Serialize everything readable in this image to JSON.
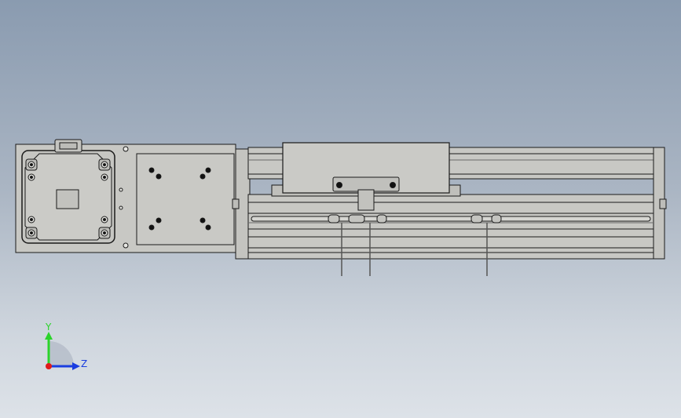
{
  "view": {
    "triad": {
      "y_label": "Y",
      "z_label": "Z",
      "y_color": "#2bd42b",
      "z_color": "#1a3de0",
      "x_color": "#e01a1a"
    },
    "model": {
      "body_color": "#c8c8c4",
      "edge_color": "#1a1a1a",
      "hole_color": "#111111"
    }
  }
}
